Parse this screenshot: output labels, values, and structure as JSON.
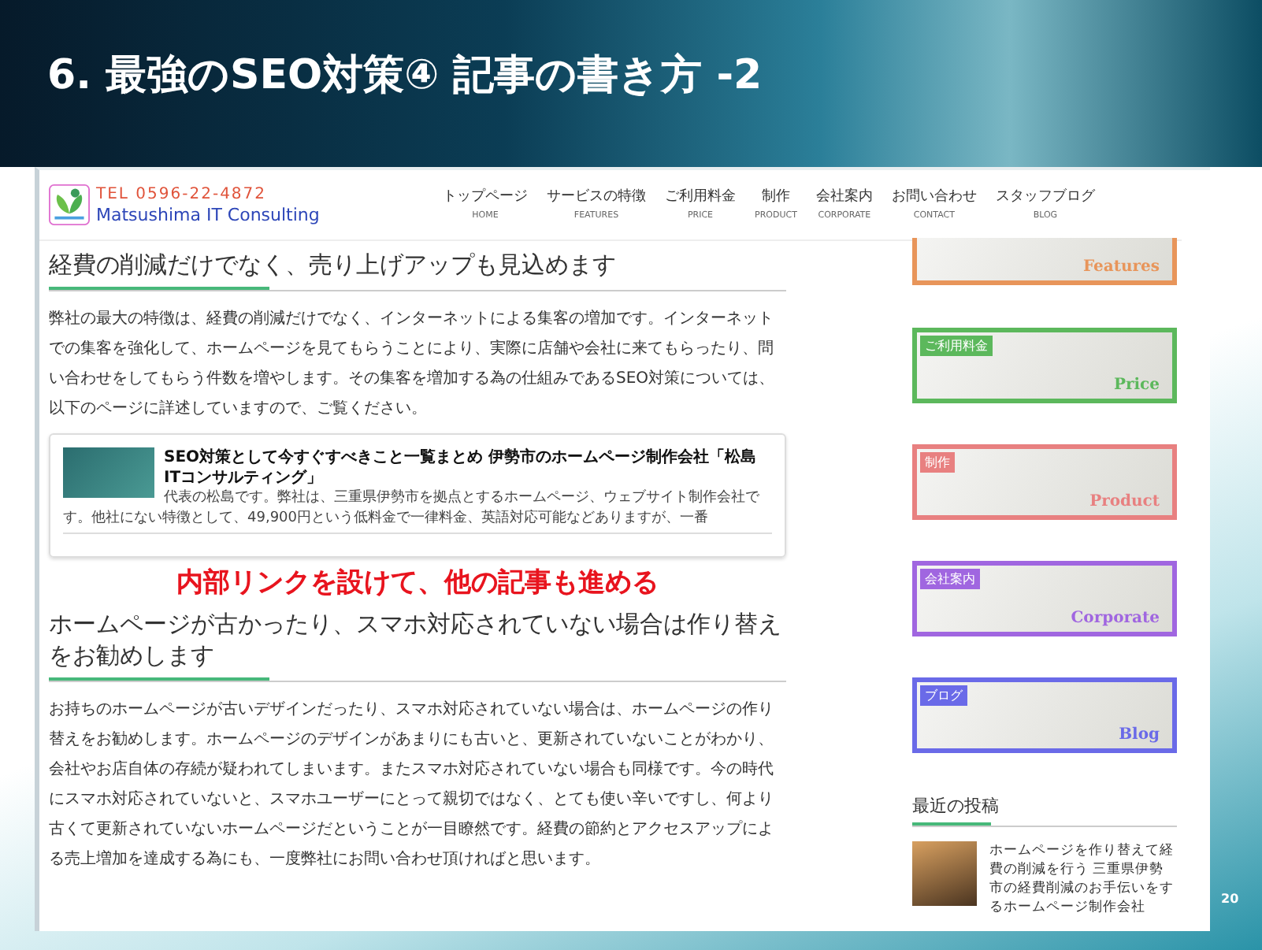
{
  "slide": {
    "title": "6. 最強のSEO対策④ 記事の書き方 -2",
    "page_number": "20"
  },
  "site": {
    "logo": {
      "tel": "TEL 0596-22-4872",
      "name": "Matsushima IT Consulting"
    },
    "nav": [
      {
        "label": "トップページ",
        "sub": "HOME"
      },
      {
        "label": "サービスの特徴",
        "sub": "FEATURES"
      },
      {
        "label": "ご利用料金",
        "sub": "PRICE"
      },
      {
        "label": "制作",
        "sub": "PRODUCT"
      },
      {
        "label": "会社案内",
        "sub": "CORPORATE"
      },
      {
        "label": "お問い合わせ",
        "sub": "CONTACT"
      },
      {
        "label": "スタッフブログ",
        "sub": "BLOG"
      }
    ],
    "content": [
      {
        "kind": "heading",
        "text": "経費の削減だけでなく、売り上げアップも見込めます"
      },
      {
        "kind": "paragraph",
        "text": "弊社の最大の特徴は、経費の削減だけでなく、インターネットによる集客の増加です。インターネットでの集客を強化して、ホームページを見てもらうことにより、実際に店舗や会社に来てもらったり、問い合わせをしてもらう件数を増やします。その集客を増加する為の仕組みであるSEO対策については、以下のページに詳述していますので、ご覧ください。"
      },
      {
        "kind": "link_card",
        "title": "SEO対策として今すぐすべきこと一覧まとめ 伊勢市のホームページ制作会社「松島ITコンサルティング」",
        "excerpt": "代表の松島です。弊社は、三重県伊勢市を拠点とするホームページ、ウェブサイト制作会社です。他社にない特徴として、49,900円という低料金で一律料金、英語対応可能などありますが、一番"
      },
      {
        "kind": "callout",
        "text": "内部リンクを設けて、他の記事も進める"
      },
      {
        "kind": "heading",
        "text": "ホームページが古かったり、スマホ対応されていない場合は作り替えをお勧めします"
      },
      {
        "kind": "paragraph",
        "text": "お持ちのホームページが古いデザインだったり、スマホ対応されていない場合は、ホームページの作り替えをお勧めします。ホームページのデザインがあまりにも古いと、更新されていないことがわかり、会社やお店自体の存続が疑われてしまいます。またスマホ対応されていない場合も同様です。今の時代にスマホ対応されていないと、スマホユーザーにとって親切ではなく、とても使い辛いですし、何より古くて更新されていないホームページだということが一目瞭然です。経費の節約とアクセスアップによる売上増加を達成する為にも、一度弊社にお問い合わせ頂ければと思います。"
      }
    ],
    "sidebar": {
      "banners": [
        {
          "word": "Features",
          "color": "#e8955a"
        },
        {
          "label": "ご利用料金",
          "word": "Price",
          "color": "#5cb85c"
        },
        {
          "label": "制作",
          "word": "Product",
          "color": "#e88080"
        },
        {
          "label": "会社案内",
          "word": "Corporate",
          "color": "#a066e0"
        },
        {
          "label": "ブログ",
          "word": "Blog",
          "color": "#6a6ae8"
        }
      ],
      "recent_posts": {
        "heading": "最近の投稿",
        "items": [
          {
            "title": "ホームページを作り替えて経費の削減を行う 三重県伊勢市の経費削減のお手伝いをするホームページ制作会社"
          }
        ]
      }
    }
  }
}
